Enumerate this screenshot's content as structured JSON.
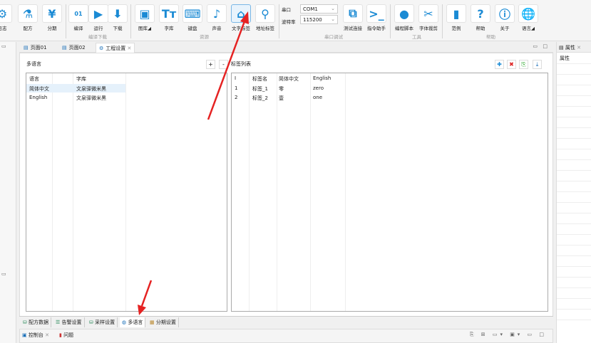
{
  "toolbar": {
    "buttons": [
      {
        "label": "日志",
        "icon": "log-gear-icon"
      },
      {
        "label": "配方",
        "icon": "recipe-flask-icon"
      },
      {
        "label": "分期",
        "icon": "installment-icon"
      },
      {
        "label": "编译",
        "icon": "compile-binary-icon"
      },
      {
        "label": "运行",
        "icon": "play-icon"
      },
      {
        "label": "下载",
        "icon": "download-icon"
      },
      {
        "label": "图库◢",
        "icon": "image-gallery-icon"
      },
      {
        "label": "字库",
        "icon": "font-icon"
      },
      {
        "label": "键盘",
        "icon": "keyboard-icon"
      },
      {
        "label": "声音",
        "icon": "sound-folder-icon"
      },
      {
        "label": "文字标签",
        "icon": "text-tag-icon"
      },
      {
        "label": "地址标签",
        "icon": "address-tag-icon"
      },
      {
        "label": "测试连接",
        "icon": "test-connection-icon"
      },
      {
        "label": "指令助手",
        "icon": "command-assistant-icon"
      },
      {
        "label": "编程脚本",
        "icon": "lua-script-icon"
      },
      {
        "label": "字体裁剪",
        "icon": "scissors-icon"
      },
      {
        "label": "范例",
        "icon": "bookmark-icon"
      },
      {
        "label": "帮助",
        "icon": "help-doc-icon"
      },
      {
        "label": "关于",
        "icon": "info-icon"
      },
      {
        "label": "语言◢",
        "icon": "globe-icon"
      }
    ],
    "groups": {
      "compile": "编译下载",
      "resources": "资源",
      "serial": "串口调试",
      "tools": "工具",
      "help": "帮助"
    },
    "serial": {
      "port_label": "串口",
      "port_value": "COM1",
      "baud_label": "波特率",
      "baud_value": "115200"
    }
  },
  "tabs": [
    {
      "label": "页面01"
    },
    {
      "label": "页面02"
    },
    {
      "label": "工程设置",
      "close": "✕"
    }
  ],
  "properties": {
    "title": "属性",
    "subtitle": "属性"
  },
  "editor": {
    "section_title": "多语言",
    "add": "+",
    "remove": "-",
    "label_list_title": "标签列表",
    "lang_table": {
      "headers": [
        "语言",
        "字库"
      ],
      "rows": [
        [
          "简体中文",
          "文泉驿微米黑"
        ],
        [
          "English",
          "文泉驿微米黑"
        ]
      ]
    },
    "label_table": {
      "headers": [
        "I",
        "标签名",
        "简体中文",
        "English"
      ],
      "rows": [
        [
          "1",
          "标签_1",
          "零",
          "zero"
        ],
        [
          "2",
          "标签_2",
          "壹",
          "one"
        ]
      ]
    }
  },
  "bottom_tabs": [
    "配方数据",
    "告警设置",
    "采样设置",
    "多语言",
    "分期设置"
  ],
  "console": {
    "tabs": [
      "控制台",
      "问题"
    ]
  }
}
